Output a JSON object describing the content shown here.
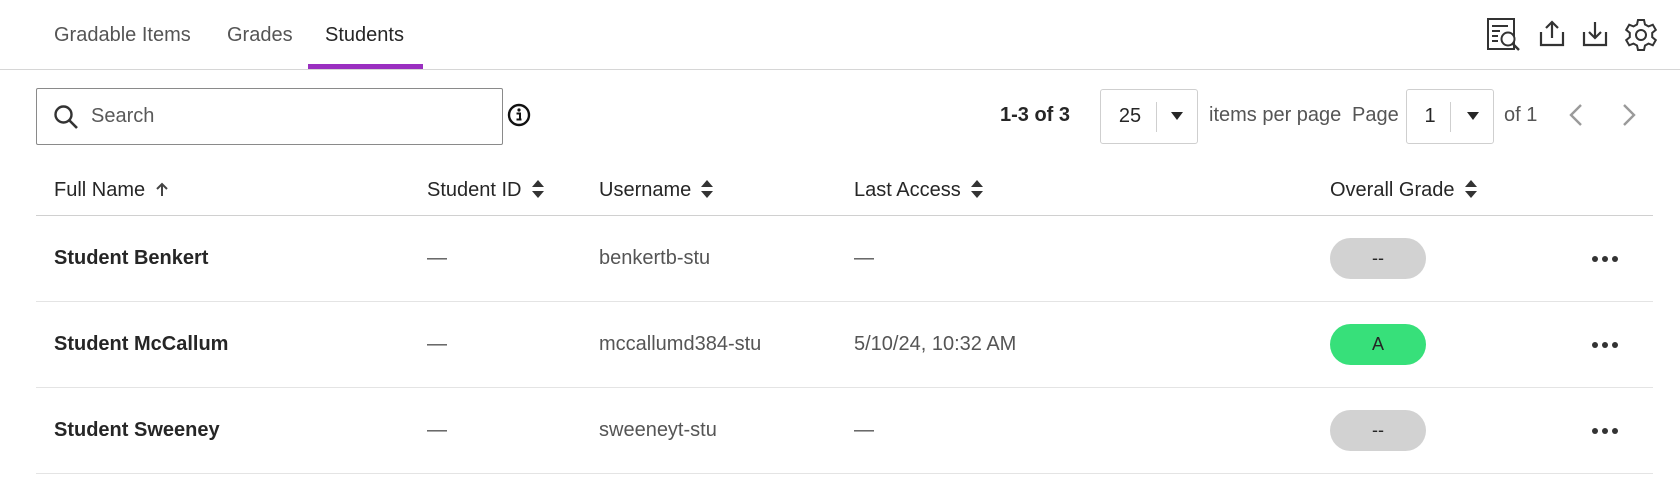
{
  "tabs": [
    {
      "label": "Gradable Items",
      "active": false
    },
    {
      "label": "Grades",
      "active": false
    },
    {
      "label": "Students",
      "active": true
    }
  ],
  "accent_color": "#9a2fc0",
  "toolbar_icons": [
    "grade-search-icon",
    "upload-icon",
    "download-icon",
    "settings-gear-icon"
  ],
  "search": {
    "placeholder": "Search",
    "value": ""
  },
  "pagination": {
    "range": "1-3 of 3",
    "items_per_page": "25",
    "items_per_page_label": "items per page",
    "page_label": "Page",
    "current_page": "1",
    "of_pages": "of 1"
  },
  "columns": [
    {
      "label": "Full Name",
      "sort": "ascending"
    },
    {
      "label": "Student ID",
      "sort": "none"
    },
    {
      "label": "Username",
      "sort": "none"
    },
    {
      "label": "Last Access",
      "sort": "none"
    },
    {
      "label": "Overall Grade",
      "sort": "none"
    }
  ],
  "rows": [
    {
      "full_name": "Student Benkert",
      "student_id": "—",
      "username": "benkertb-stu",
      "last_access": "—",
      "grade": "--",
      "grade_color": "#d2d2d2"
    },
    {
      "full_name": "Student McCallum",
      "student_id": "—",
      "username": "mccallumd384-stu",
      "last_access": "5/10/24, 10:32 AM",
      "grade": "A",
      "grade_color": "#37e07a"
    },
    {
      "full_name": "Student Sweeney",
      "student_id": "—",
      "username": "sweeneyt-stu",
      "last_access": "—",
      "grade": "--",
      "grade_color": "#d2d2d2"
    }
  ]
}
